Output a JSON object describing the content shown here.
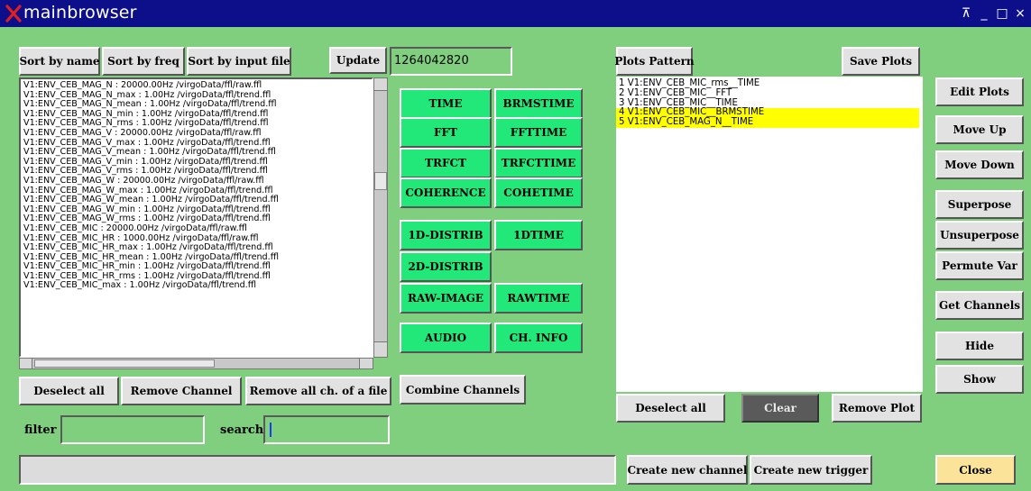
{
  "window": {
    "title": "mainbrowser",
    "controls": [
      "⊼",
      "_",
      "□",
      "×"
    ]
  },
  "toolbar": {
    "sort_name": "Sort by name",
    "sort_freq": "Sort by freq",
    "sort_file": "Sort by input file",
    "update": "Update",
    "gps_value": "1264042820"
  },
  "channels": [
    "V1:ENV_CEB_MAG_N : 20000.00Hz /virgoData/ffl/raw.ffl",
    "V1:ENV_CEB_MAG_N_max : 1.00Hz /virgoData/ffl/trend.ffl",
    "V1:ENV_CEB_MAG_N_mean : 1.00Hz /virgoData/ffl/trend.ffl",
    "V1:ENV_CEB_MAG_N_min : 1.00Hz /virgoData/ffl/trend.ffl",
    "V1:ENV_CEB_MAG_N_rms : 1.00Hz /virgoData/ffl/trend.ffl",
    "V1:ENV_CEB_MAG_V : 20000.00Hz /virgoData/ffl/raw.ffl",
    "V1:ENV_CEB_MAG_V_max : 1.00Hz /virgoData/ffl/trend.ffl",
    "V1:ENV_CEB_MAG_V_mean : 1.00Hz /virgoData/ffl/trend.ffl",
    "V1:ENV_CEB_MAG_V_min : 1.00Hz /virgoData/ffl/trend.ffl",
    "V1:ENV_CEB_MAG_V_rms : 1.00Hz /virgoData/ffl/trend.ffl",
    "V1:ENV_CEB_MAG_W : 20000.00Hz /virgoData/ffl/raw.ffl",
    "V1:ENV_CEB_MAG_W_max : 1.00Hz /virgoData/ffl/trend.ffl",
    "V1:ENV_CEB_MAG_W_mean : 1.00Hz /virgoData/ffl/trend.ffl",
    "V1:ENV_CEB_MAG_W_min : 1.00Hz /virgoData/ffl/trend.ffl",
    "V1:ENV_CEB_MAG_W_rms : 1.00Hz /virgoData/ffl/trend.ffl",
    "V1:ENV_CEB_MIC : 20000.00Hz /virgoData/ffl/raw.ffl",
    "V1:ENV_CEB_MIC_HR : 1000.00Hz /virgoData/ffl/raw.ffl",
    "V1:ENV_CEB_MIC_HR_max : 1.00Hz /virgoData/ffl/trend.ffl",
    "V1:ENV_CEB_MIC_HR_mean : 1.00Hz /virgoData/ffl/trend.ffl",
    "V1:ENV_CEB_MIC_HR_min : 1.00Hz /virgoData/ffl/trend.ffl",
    "V1:ENV_CEB_MIC_HR_rms : 1.00Hz /virgoData/ffl/trend.ffl",
    "V1:ENV_CEB_MIC_max : 1.00Hz /virgoData/ffl/trend.ffl"
  ],
  "plot_types": {
    "time": "TIME",
    "brmstime": "BRMSTIME",
    "fft": "FFT",
    "ffttime": "FFTTIME",
    "trfct": "TRFCT",
    "trfcttime": "TRFCTTIME",
    "coherence": "COHERENCE",
    "cohetime": "COHETIME",
    "distrib1d": "1D-DISTRIB",
    "dtime1": "1DTIME",
    "distrib2d": "2D-DISTRIB",
    "rawimage": "RAW-IMAGE",
    "rawtime": "RAWTIME",
    "audio": "AUDIO",
    "chinfo": "CH. INFO"
  },
  "left_bottom": {
    "deselect_all": "Deselect all",
    "remove_channel": "Remove Channel",
    "remove_all_file": "Remove all ch. of a file",
    "combine": "Combine Channels",
    "filter_label": "filter",
    "search_label": "search"
  },
  "plots": {
    "pattern": "Plots Pattern",
    "save": "Save Plots",
    "items": [
      {
        "text": "1  V1:ENV_CEB_MIC_rms__TIME"
      },
      {
        "text": "2  V1:ENV_CEB_MIC__FFT"
      },
      {
        "text": "3  V1:ENV_CEB_MIC__TIME"
      },
      {
        "text": "4  V1:ENV_CEB_MIC__BRMSTIME"
      },
      {
        "text": "5  V1:ENV_CEB_MAG_N__TIME"
      }
    ],
    "deselect_all": "Deselect all",
    "clear": "Clear",
    "remove_plot": "Remove Plot"
  },
  "right_panel": {
    "edit_plots": "Edit Plots",
    "move_up": "Move Up",
    "move_down": "Move Down",
    "superpose": "Superpose",
    "unsuperpose": "Unsuperpose",
    "permute_var": "Permute Var",
    "get_channels": "Get Channels",
    "hide": "Hide",
    "show": "Show",
    "close": "Close"
  },
  "bottom": {
    "create_channel": "Create new channel",
    "create_trigger": "Create new trigger"
  },
  "colors": {
    "background": "#7fcf7f",
    "titlebar": "#0d0f8a",
    "green_button": "#22e87a",
    "highlight": "#ffff00",
    "close_button": "#fbe39a"
  }
}
